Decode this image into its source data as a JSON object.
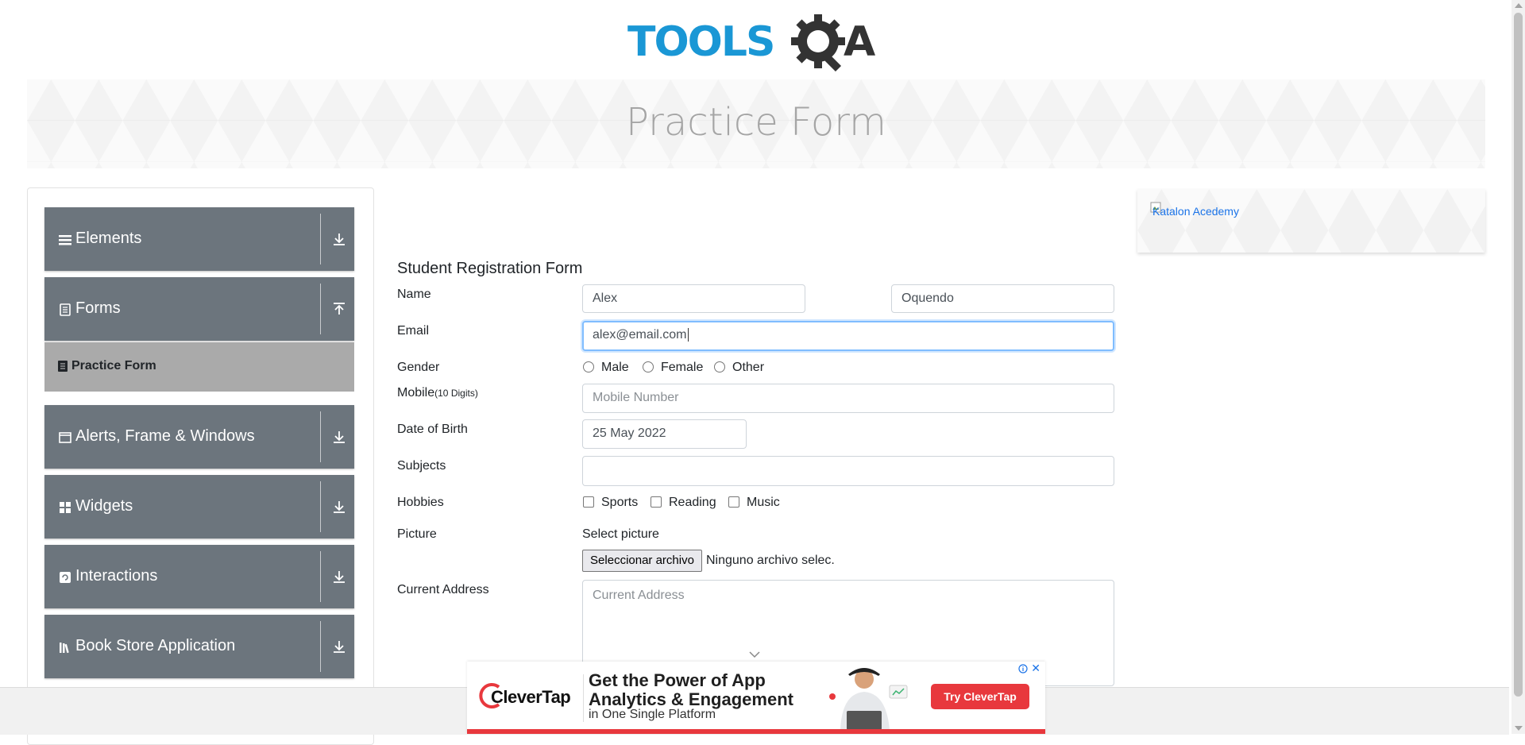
{
  "header": {
    "logo_text": "TOOLSQA",
    "page_title": "Practice Form"
  },
  "sidebar": {
    "groups": [
      {
        "label": "Elements",
        "icon": "menu-icon",
        "state": "collapsed"
      },
      {
        "label": "Forms",
        "icon": "document-icon",
        "state": "expanded"
      },
      {
        "label": "Alerts, Frame & Windows",
        "icon": "window-icon",
        "state": "collapsed"
      },
      {
        "label": "Widgets",
        "icon": "widgets-icon",
        "state": "collapsed"
      },
      {
        "label": "Interactions",
        "icon": "interaction-icon",
        "state": "collapsed"
      },
      {
        "label": "Book Store Application",
        "icon": "books-icon",
        "state": "collapsed"
      }
    ],
    "forms_subitems": [
      {
        "label": "Practice Form",
        "active": true
      }
    ]
  },
  "form": {
    "title": "Student Registration Form",
    "name_label": "Name",
    "first_name_value": "Alex",
    "last_name_value": "Oquendo",
    "email_label": "Email",
    "email_value": "alex@email.com",
    "gender_label": "Gender",
    "gender_options": [
      "Male",
      "Female",
      "Other"
    ],
    "mobile_label": "Mobile",
    "mobile_hint": "(10 Digits)",
    "mobile_placeholder": "Mobile Number",
    "dob_label": "Date of Birth",
    "dob_value": "25 May 2022",
    "subjects_label": "Subjects",
    "subjects_value": "",
    "hobbies_label": "Hobbies",
    "hobby_options": [
      "Sports",
      "Reading",
      "Music"
    ],
    "picture_label": "Picture",
    "select_picture_label": "Select picture",
    "file_button_label": "Seleccionar archivo",
    "file_status": "Ninguno archivo selec.",
    "address_label": "Current Address",
    "address_placeholder": "Current Address"
  },
  "right_ad": {
    "alt_text": "Katalon Acedemy"
  },
  "bottom_ad": {
    "brand": "CleverTap",
    "headline_1": "Get the Power of App",
    "headline_2": "Analytics & Engagement",
    "subline": "in One Single Platform",
    "cta": "Try CleverTap"
  },
  "colors": {
    "sidebar_group_bg": "#6c757d",
    "sidebar_active_bg": "#aaaaaa",
    "focus_border": "#80bdff",
    "logo_blue": "#1a97d5",
    "logo_dark": "#333333",
    "ad_red": "#e8383d"
  }
}
